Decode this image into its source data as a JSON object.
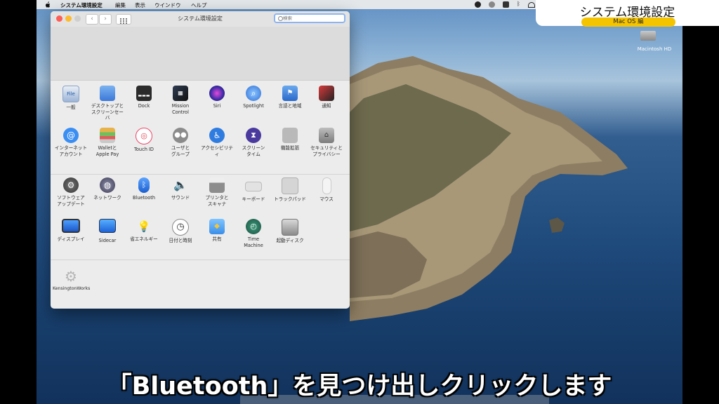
{
  "menubar": {
    "items": [
      "システム環境設定",
      "編集",
      "表示",
      "ウインドウ",
      "ヘルプ"
    ]
  },
  "desktop": {
    "disk_label": "Macintosh HD"
  },
  "window": {
    "title": "システム環境設定",
    "search_placeholder": "検索"
  },
  "panes": {
    "row1": [
      {
        "label": "一般",
        "icon": "general-icon"
      },
      {
        "label": "デスクトップと\nスクリーンセーバ",
        "icon": "desktop-icon"
      },
      {
        "label": "Dock",
        "icon": "dock-icon"
      },
      {
        "label": "Mission\nControl",
        "icon": "mission-control-icon"
      },
      {
        "label": "Siri",
        "icon": "siri-icon"
      },
      {
        "label": "Spotlight",
        "icon": "spotlight-icon"
      },
      {
        "label": "言語と地域",
        "icon": "language-flag-icon"
      },
      {
        "label": "通知",
        "icon": "notifications-icon"
      }
    ],
    "row2": [
      {
        "label": "インターネット\nアカウント",
        "icon": "at-icon"
      },
      {
        "label": "Walletと\nApple Pay",
        "icon": "wallet-icon"
      },
      {
        "label": "Touch ID",
        "icon": "fingerprint-icon"
      },
      {
        "label": "ユーザと\nグループ",
        "icon": "users-icon"
      },
      {
        "label": "アクセシビリティ",
        "icon": "accessibility-icon"
      },
      {
        "label": "スクリーン\nタイム",
        "icon": "hourglass-icon"
      },
      {
        "label": "機能拡張",
        "icon": "puzzle-icon"
      },
      {
        "label": "セキュリティと\nプライバシー",
        "icon": "house-lock-icon"
      }
    ],
    "row3": [
      {
        "label": "ソフトウェア\nアップデート",
        "icon": "software-update-icon"
      },
      {
        "label": "ネットワーク",
        "icon": "globe-icon"
      },
      {
        "label": "Bluetooth",
        "icon": "bluetooth-icon"
      },
      {
        "label": "サウンド",
        "icon": "speaker-icon"
      },
      {
        "label": "プリンタと\nスキャナ",
        "icon": "printer-icon"
      },
      {
        "label": "キーボード",
        "icon": "keyboard-icon"
      },
      {
        "label": "トラックパッド",
        "icon": "trackpad-icon"
      },
      {
        "label": "マウス",
        "icon": "mouse-icon"
      }
    ],
    "row4": [
      {
        "label": "ディスプレイ",
        "icon": "display-icon"
      },
      {
        "label": "Sidecar",
        "icon": "sidecar-icon"
      },
      {
        "label": "省エネルギー",
        "icon": "bulb-icon"
      },
      {
        "label": "日付と時刻",
        "icon": "clock-icon"
      },
      {
        "label": "共有",
        "icon": "sharing-folder-icon"
      },
      {
        "label": "Time\nMachine",
        "icon": "time-machine-icon"
      },
      {
        "label": "起動ディスク",
        "icon": "startup-disk-icon"
      }
    ],
    "row5": [
      {
        "label": "KensingtonWorks",
        "icon": "kensington-gear-icon"
      }
    ]
  },
  "badge": {
    "title": "システム環境設定",
    "subtitle": "Mac OS 編"
  },
  "caption": "「Bluetooth」を見つけ出しクリックします"
}
